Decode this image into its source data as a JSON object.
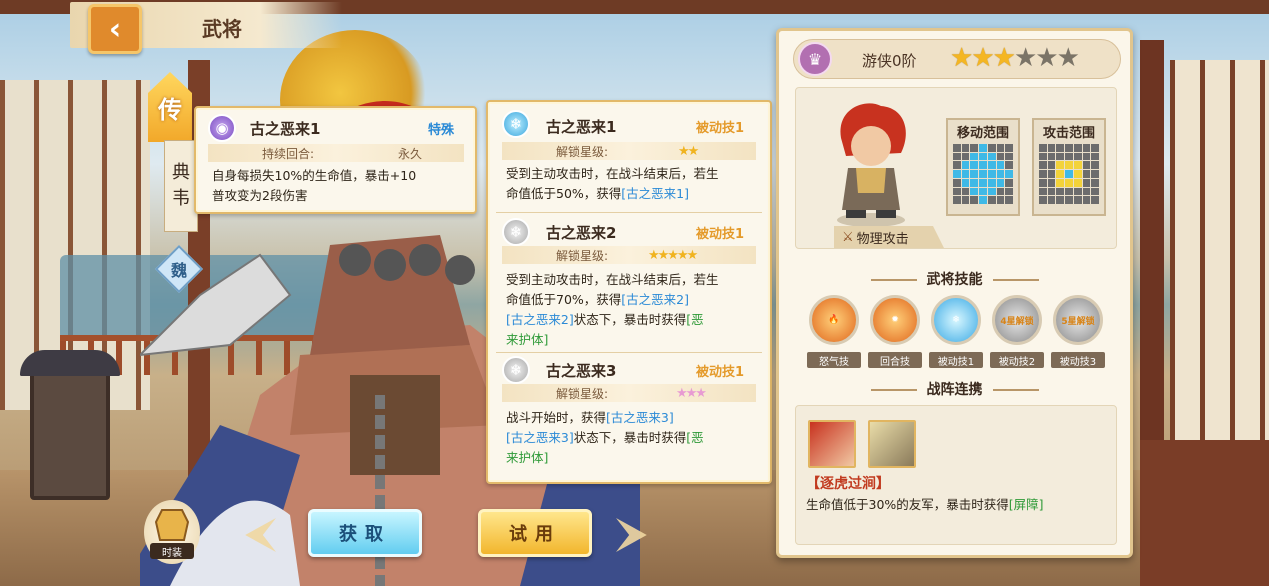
{
  "header": {
    "title": "武将",
    "back_icon": "back-arrow-icon"
  },
  "general": {
    "rank_glyph": "传",
    "name_chars": [
      "典",
      "韦"
    ],
    "faction": "魏",
    "class_rank": "游侠0阶",
    "stars": {
      "filled": 3,
      "total": 6
    },
    "attack_type": "物理攻击",
    "move_range_label": "移动范围",
    "attack_range_label": "攻击范围"
  },
  "status_popup": {
    "name": "古之恶来1",
    "type": "特殊",
    "duration_label": "持续回合:",
    "duration_value": "永久",
    "desc_line1": "自身每损失10%的生命值，暴击+10",
    "desc_line2": "普攻变为2段伤害"
  },
  "skill_popup": {
    "items": [
      {
        "name": "古之恶来1",
        "type": "被动技1",
        "unlock_label": "解锁星级:",
        "stars": "★★",
        "line1": "受到主动攻击时，在战斗结束后，若生",
        "line2_a": "命值低于50%，获得",
        "line2_b": "[古之恶来1]"
      },
      {
        "name": "古之恶来2",
        "type": "被动技1",
        "unlock_label": "解锁星级:",
        "stars": "★★★★★",
        "line1": "受到主动攻击时，在战斗结束后，若生",
        "line2_a": "命值低于70%，获得",
        "line2_b": "[古之恶来2]",
        "line3_a": "[古之恶来2]",
        "line3_b": "状态下，暴击时获得",
        "line3_c": "[恶",
        "line4": "来护体]"
      },
      {
        "name": "古之恶来3",
        "type": "被动技1",
        "unlock_label": "解锁星级:",
        "stars": "★★★",
        "line1_a": "战斗开始时，获得",
        "line1_b": "[古之恶来3]",
        "line2_a": "[古之恶来3]",
        "line2_b": "状态下，暴击时获得",
        "line2_c": "[恶",
        "line3": "来护体]"
      }
    ]
  },
  "skills_section": {
    "title": "武将技能",
    "skills": [
      {
        "label": "怒气技",
        "locked_text": ""
      },
      {
        "label": "回合技",
        "locked_text": ""
      },
      {
        "label": "被动技1",
        "locked_text": ""
      },
      {
        "label": "被动技2",
        "locked_text": "4星解锁"
      },
      {
        "label": "被动技3",
        "locked_text": "5星解锁"
      }
    ]
  },
  "combo_section": {
    "title": "战阵连携",
    "combo_name": "【逐虎过涧】",
    "desc_a": "生命值低于30%的友军，暴击时获得",
    "desc_b": "[屏障]"
  },
  "actions": {
    "obtain": "获取",
    "try": "试用",
    "costume": "时装"
  },
  "colors": {
    "accent_orange": "#e08a2c",
    "skill_blue": "#2b8ad6",
    "skill_green": "#2f9a38",
    "passive_orange": "#e49a2a"
  }
}
